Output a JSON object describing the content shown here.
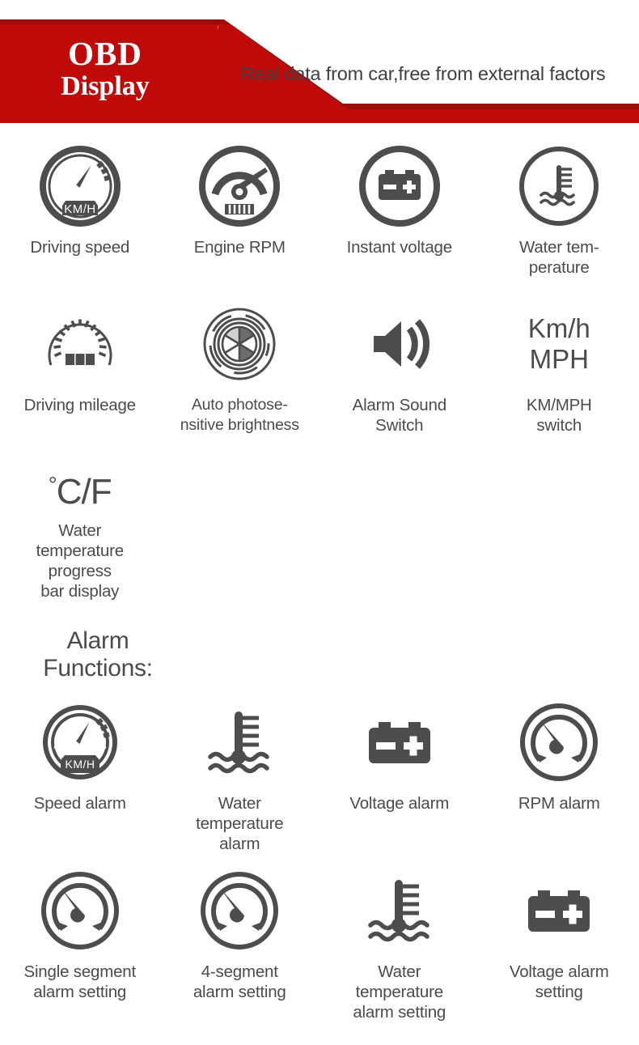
{
  "header": {
    "title": "OBD",
    "subtitle": "Display",
    "tagline": "Real data from car,free from external factors",
    "brand_red": "#c00a0a",
    "outline_red": "#9e0b0b"
  },
  "theme": {
    "icon_gray": "#4d4d4d",
    "text_gray": "#4b4b4b",
    "background": "#ffffff"
  },
  "features_row1": [
    {
      "icon": "speedometer-kmh-icon",
      "label": "Driving speed",
      "gauge_unit": "KM/H"
    },
    {
      "icon": "rpm-gauge-icon",
      "label": "Engine RPM"
    },
    {
      "icon": "battery-icon",
      "label": "Instant voltage"
    },
    {
      "icon": "water-temperature-icon",
      "label": "Water tem-\nperature"
    }
  ],
  "features_row2": [
    {
      "icon": "odometer-icon",
      "label": "Driving mileage"
    },
    {
      "icon": "aperture-icon",
      "label": "Auto photose-\nnsitive brightness"
    },
    {
      "icon": "speaker-icon",
      "label": "Alarm Sound\nSwitch"
    },
    {
      "icon": "kmh-mph-text-icon",
      "glyph": "Km/h\nMPH",
      "label": "KM/MPH\nswitch"
    }
  ],
  "celsius_fahrenheit": {
    "icon": "degree-cf-text-icon",
    "degree_symbol": "°",
    "glyph": "C/F",
    "label": "Water\ntemperature\nprogress\nbar display"
  },
  "alarm_section": {
    "heading": "Alarm\nFunctions:",
    "features_row3": [
      {
        "icon": "speedometer-kmh-icon",
        "label": "Speed alarm",
        "gauge_unit": "KM/H"
      },
      {
        "icon": "thermometer-water-icon",
        "label": "Water\ntemperature\nalarm"
      },
      {
        "icon": "battery-plain-icon",
        "label": "Voltage alarm"
      },
      {
        "icon": "rpm-dial-icon",
        "label": "RPM alarm"
      }
    ],
    "features_row4": [
      {
        "icon": "rpm-dial-icon",
        "label": "Single segment\nalarm setting"
      },
      {
        "icon": "rpm-dial-icon",
        "label": "4-segment\nalarm setting"
      },
      {
        "icon": "thermometer-water-icon",
        "label": "Water\ntemperature\nalarm setting"
      },
      {
        "icon": "battery-plain-icon",
        "label": "Voltage alarm\nsetting"
      }
    ]
  }
}
